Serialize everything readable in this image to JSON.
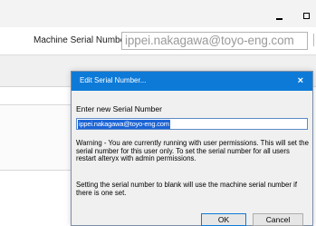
{
  "window": {
    "minimize_glyph": "_",
    "maximize_icon": "maximize-icon"
  },
  "main": {
    "serial_label": "Machine Serial Number",
    "serial_value": "ippei.nakagawa@toyo-eng.com"
  },
  "dialog": {
    "title": "Edit Serial Number...",
    "close_glyph": "×",
    "prompt": "Enter new Serial Number",
    "input_value": "ippei.nakagawa@toyo-eng.com",
    "warning": "Warning - You are currently running with user permissions. This will set the serial number for this user only.  To set the serial number for all users restart alteryx with admin permissions.",
    "blank_note": "Setting the serial number to blank will use the machine serial number if there is one set.",
    "ok_label": "OK",
    "cancel_label": "Cancel"
  },
  "colors": {
    "dialog_title_bar": "#0d7ad8",
    "selection": "#1b64d6"
  }
}
